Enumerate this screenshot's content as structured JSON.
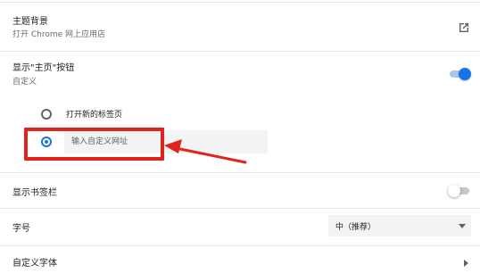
{
  "theme": {
    "title": "主题背景",
    "subtitle": "打开 Chrome 网上应用店",
    "icon": "open-in-new-icon"
  },
  "home_button": {
    "title": "显示\"主页\"按钮",
    "subtitle": "自定义",
    "toggle_on": true,
    "accent_color": "#1a73e8",
    "options": [
      {
        "label": "打开新的标签页",
        "checked": false
      },
      {
        "label": "",
        "checked": true
      }
    ],
    "custom_url_placeholder": "输入自定义网址"
  },
  "bookmarks_bar": {
    "title": "显示书签栏",
    "toggle_on": false
  },
  "font_size": {
    "title": "字号",
    "selected": "中（推荐）"
  },
  "custom_fonts": {
    "title": "自定义字体"
  },
  "annotation": {
    "color": "#e0241c"
  }
}
